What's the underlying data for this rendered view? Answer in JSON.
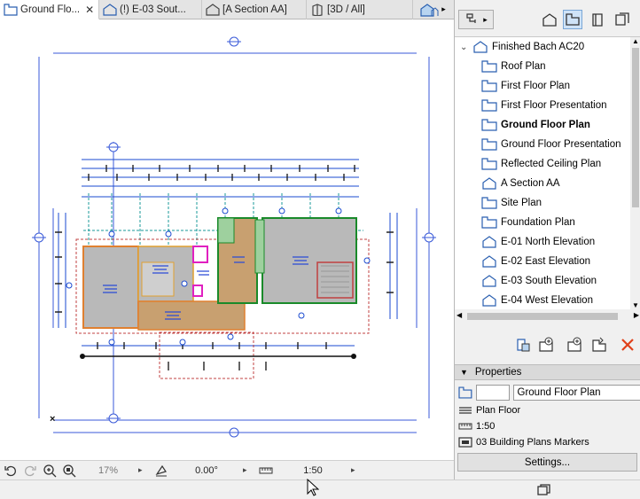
{
  "tabs": [
    {
      "label": "Ground Flo...",
      "icon": "floor-plan-icon",
      "active": true
    },
    {
      "label": "(!) E-03 Sout...",
      "icon": "elevation-icon"
    },
    {
      "label": "[A Section AA]",
      "icon": "section-icon"
    },
    {
      "label": "[3D / All]",
      "icon": "3d-icon"
    }
  ],
  "tab_close": "✕",
  "status_bar": {
    "zoom": "17%",
    "angle": "0.00°",
    "scale": "1:50"
  },
  "navigator": {
    "project": "Finished Bach AC20",
    "items": [
      {
        "label": "Roof Plan",
        "icon": "floor-plan-icon"
      },
      {
        "label": "First Floor Plan",
        "icon": "floor-plan-icon"
      },
      {
        "label": "First Floor Presentation",
        "icon": "floor-plan-icon"
      },
      {
        "label": "Ground Floor Plan",
        "icon": "floor-plan-icon",
        "bold": true
      },
      {
        "label": "Ground Floor Presentation",
        "icon": "floor-plan-icon"
      },
      {
        "label": "Reflected Ceiling Plan",
        "icon": "floor-plan-icon"
      },
      {
        "label": "A Section AA",
        "icon": "section-icon"
      },
      {
        "label": "Site Plan",
        "icon": "floor-plan-icon"
      },
      {
        "label": "Foundation Plan",
        "icon": "floor-plan-icon"
      },
      {
        "label": "E-01 North Elevation",
        "icon": "elevation-icon"
      },
      {
        "label": "E-02 East Elevation",
        "icon": "elevation-icon"
      },
      {
        "label": "E-03 South Elevation",
        "icon": "elevation-icon"
      },
      {
        "label": "E-04 West Elevation",
        "icon": "elevation-icon"
      }
    ]
  },
  "properties": {
    "header": "Properties",
    "id_value": "",
    "name_value": "Ground Floor Plan",
    "story": "Plan Floor",
    "scale": "1:50",
    "layer_combo": "03 Building Plans Markers",
    "settings_label": "Settings..."
  },
  "colors": {
    "accent": "#0078d7",
    "selection": "#cfe3f7",
    "delete": "#e0401a",
    "drawing_blue": "#2a4bd6",
    "drawing_cyan": "#1a9a9a",
    "drawing_orange": "#e08030",
    "drawing_green": "#1a8a2a",
    "drawing_magenta": "#e020c0"
  }
}
